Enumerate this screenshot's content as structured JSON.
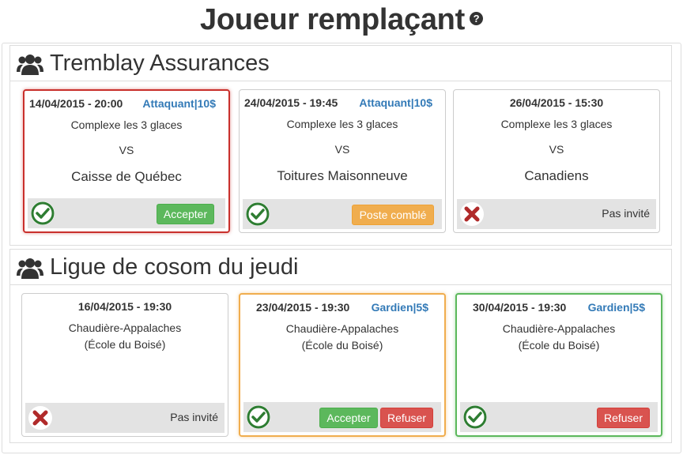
{
  "page": {
    "title": "Joueur remplaçant",
    "help_icon": "?"
  },
  "colors": {
    "accept": "#5cb85c",
    "filled": "#f0ad4e",
    "refuse": "#d9534f",
    "role_link": "#337ab7"
  },
  "sections": [
    {
      "title": "Tremblay Assurances",
      "icon": "group-icon",
      "cards": [
        {
          "date": "14/04/2015 - 20:00",
          "role": "Attaquant|10$",
          "venue": "Complexe les 3 glaces",
          "vs": "VS",
          "opponent": "Caisse de Québec",
          "status_icon": "check-icon",
          "button": "Accepter"
        },
        {
          "date": "24/04/2015 - 19:45",
          "role": "Attaquant|10$",
          "venue": "Complexe les 3 glaces",
          "vs": "VS",
          "opponent": "Toitures Maisonneuve",
          "status_icon": "check-icon",
          "button": "Poste comblé"
        },
        {
          "date": "26/04/2015 - 15:30",
          "venue": "Complexe les 3 glaces",
          "vs": "VS",
          "opponent": "Canadiens",
          "status_icon": "x-icon",
          "status_text": "Pas invité"
        }
      ]
    },
    {
      "title": "Ligue de cosom du jeudi",
      "icon": "group-icon",
      "cards": [
        {
          "date": "16/04/2015 - 19:30",
          "venue_line1": "Chaudière-Appalaches",
          "venue_line2": "(École du Boisé)",
          "status_icon": "x-icon",
          "status_text": "Pas invité"
        },
        {
          "date": "23/04/2015 - 19:30",
          "role": "Gardien|5$",
          "venue_line1": "Chaudière-Appalaches",
          "venue_line2": "(École du Boisé)",
          "status_icon": "check-icon",
          "button_accept": "Accepter",
          "button_refuse": "Refuser"
        },
        {
          "date": "30/04/2015 - 19:30",
          "role": "Gardien|5$",
          "venue_line1": "Chaudière-Appalaches",
          "venue_line2": "(École du Boisé)",
          "status_icon": "check-icon",
          "button_refuse": "Refuser"
        }
      ]
    }
  ]
}
